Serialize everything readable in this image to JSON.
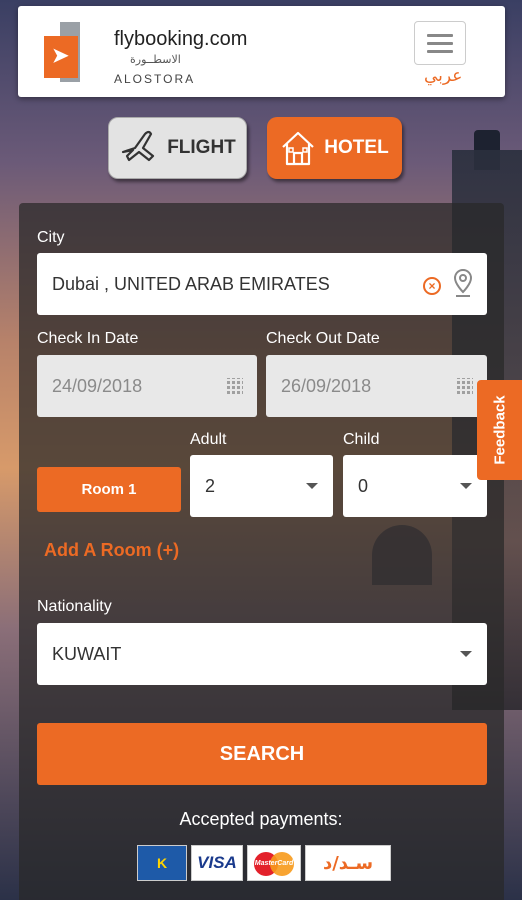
{
  "header": {
    "brand": "flybooking.com",
    "brand_arabic": "الاسطــورة",
    "brand_sub": "ALOSTORA",
    "language": "عربي",
    "menu_icon": "hamburger-icon"
  },
  "tabs": {
    "flight": {
      "label": "FLIGHT",
      "icon": "airplane-icon"
    },
    "hotel": {
      "label": "HOTEL",
      "icon": "house-icon"
    }
  },
  "form": {
    "city_label": "City",
    "city_value": "Dubai , UNITED ARAB EMIRATES",
    "checkin_label": "Check In Date",
    "checkin_value": "24/09/2018",
    "checkout_label": "Check Out Date",
    "checkout_value": "26/09/2018",
    "adult_label": "Adult",
    "adult_value": "2",
    "child_label": "Child",
    "child_value": "0",
    "room_label": "Room 1",
    "add_room": "Add A Room (+)",
    "nationality_label": "Nationality",
    "nationality_value": "KUWAIT",
    "search_label": "SEARCH"
  },
  "payments": {
    "title": "Accepted payments:",
    "knet": "K",
    "visa": "VISA",
    "mastercard": "MasterCard",
    "sadad": "سـد/د"
  },
  "feedback": "Feedback",
  "colors": {
    "accent": "#ec6a24",
    "panel": "#282828"
  }
}
